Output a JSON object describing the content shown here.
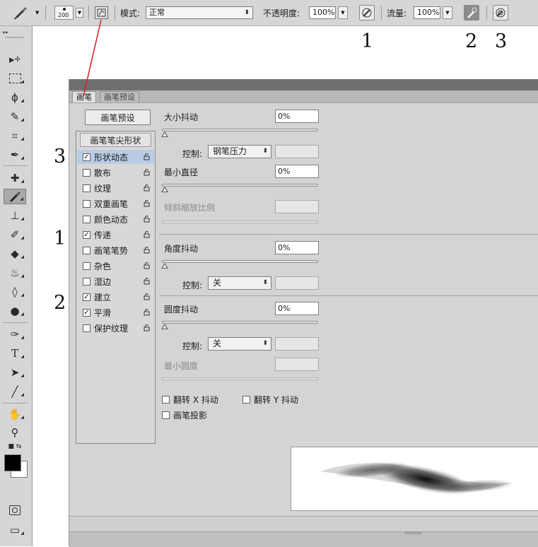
{
  "options_bar": {
    "brush_size": "200",
    "mode_label": "模式:",
    "mode_value": "正常",
    "opacity_label": "不透明度:",
    "opacity_value": "100%",
    "flow_label": "流量:",
    "flow_value": "100%"
  },
  "annotations": {
    "top_1": "1",
    "top_2": "2",
    "top_3": "3",
    "left_3": "3",
    "left_1": "1",
    "left_2": "2"
  },
  "panel": {
    "tabs": [
      "画笔",
      "画笔预设"
    ],
    "preset_button": "画笔预设",
    "tip_header": "画笔笔尖形状",
    "options": [
      {
        "label": "形状动态",
        "checked": true,
        "selected": true
      },
      {
        "label": "散布",
        "checked": false
      },
      {
        "label": "纹理",
        "checked": false
      },
      {
        "label": "双重画笔",
        "checked": false
      },
      {
        "label": "颜色动态",
        "checked": false
      },
      {
        "label": "传递",
        "checked": true
      },
      {
        "label": "画笔笔势",
        "checked": false
      },
      {
        "label": "杂色",
        "checked": false
      },
      {
        "label": "湿边",
        "checked": false
      },
      {
        "label": "建立",
        "checked": true
      },
      {
        "label": "平滑",
        "checked": true
      },
      {
        "label": "保护纹理",
        "checked": false
      }
    ],
    "size_jitter": {
      "label": "大小抖动",
      "value": "0%"
    },
    "control_label": "控制:",
    "size_control": "钢笔压力",
    "min_diameter": {
      "label": "最小直径",
      "value": "0%"
    },
    "tilt_scale": {
      "label": "倾斜缩放比例"
    },
    "angle_jitter": {
      "label": "角度抖动",
      "value": "0%"
    },
    "angle_control": "关",
    "roundness_jitter": {
      "label": "圆度抖动",
      "value": "0%"
    },
    "roundness_control": "关",
    "min_roundness": {
      "label": "最小圆度"
    },
    "flip_x": "翻转 X 抖动",
    "flip_y": "翻转 Y 抖动",
    "brush_projection": "画笔投影"
  },
  "colors": {
    "accent_annotation_line": "#d62020",
    "selection": "#b9cce4"
  }
}
